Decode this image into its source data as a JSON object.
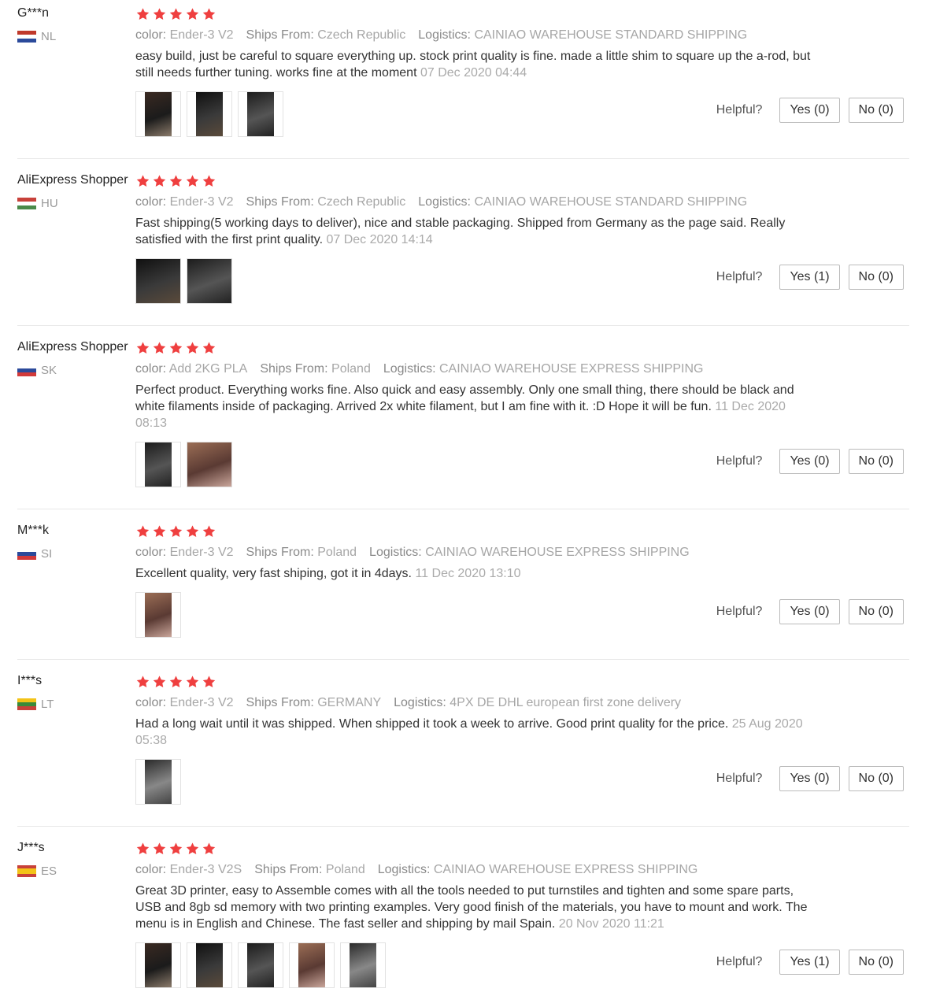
{
  "labels": {
    "color": "color:",
    "ships_from": "Ships From:",
    "logistics": "Logistics:",
    "helpful": "Helpful?"
  },
  "colors": {
    "star": "#ef3f3f",
    "divider": "#e8e8e8"
  },
  "reviews": [
    {
      "user": "G***n",
      "country": "NL",
      "flag": "flag-nl-icon",
      "stars": 5,
      "color": "Ender-3 V2",
      "ships_from": "Czech Republic",
      "logistics": "CAINIAO WAREHOUSE STANDARD SHIPPING",
      "text": "easy build, just be careful to square everything up. stock print quality is fine. made a little shim to square up the a-rod, but still needs further tuning. works fine at the moment",
      "date": "07 Dec 2020 04:44",
      "photos": 3,
      "yes": "Yes (0)",
      "no": "No (0)"
    },
    {
      "user": "AliExpress Shopper",
      "country": "HU",
      "flag": "flag-hu-icon",
      "stars": 5,
      "color": "Ender-3 V2",
      "ships_from": "Czech Republic",
      "logistics": "CAINIAO WAREHOUSE STANDARD SHIPPING",
      "text": "Fast shipping(5 working days to deliver), nice and stable packaging. Shipped from Germany as the page said. Really satisfied with the first print quality.",
      "date": "07 Dec 2020 14:14",
      "photos": 2,
      "yes": "Yes (1)",
      "no": "No (0)"
    },
    {
      "user": "AliExpress Shopper",
      "country": "SK",
      "flag": "flag-sk-icon",
      "stars": 5,
      "color": "Add 2KG PLA",
      "ships_from": "Poland",
      "logistics": "CAINIAO WAREHOUSE EXPRESS SHIPPING",
      "text": "Perfect product. Everything works fine. Also quick and easy assembly. Only one small thing, there should be black and white filaments inside of packaging. Arrived 2x white filament, but I am fine with it. :D Hope it will be fun.",
      "date": "11 Dec 2020 08:13",
      "photos": 2,
      "yes": "Yes (0)",
      "no": "No (0)"
    },
    {
      "user": "M***k",
      "country": "SI",
      "flag": "flag-si-icon",
      "stars": 5,
      "color": "Ender-3 V2",
      "ships_from": "Poland",
      "logistics": "CAINIAO WAREHOUSE EXPRESS SHIPPING",
      "text": "Excellent quality, very fast shiping, got it in 4days.",
      "date": "11 Dec 2020 13:10",
      "photos": 1,
      "yes": "Yes (0)",
      "no": "No (0)"
    },
    {
      "user": "I***s",
      "country": "LT",
      "flag": "flag-lt-icon",
      "stars": 5,
      "color": "Ender-3 V2",
      "ships_from": "GERMANY",
      "logistics": "4PX DE DHL european first zone delivery",
      "text": "Had a long wait until it was shipped. When shipped it took a week to arrive. Good print quality for the price.",
      "date": "25 Aug 2020 05:38",
      "photos": 1,
      "yes": "Yes (0)",
      "no": "No (0)"
    },
    {
      "user": "J***s",
      "country": "ES",
      "flag": "flag-es-icon",
      "stars": 5,
      "color": "Ender-3 V2S",
      "ships_from": "Poland",
      "logistics": "CAINIAO WAREHOUSE EXPRESS SHIPPING",
      "text": "Great 3D printer, easy to Assemble comes with all the tools needed to put turnstiles and tighten and some spare parts, USB and 8gb sd memory with two printing examples. Very good finish of the materials, you have to mount and work. The menu is in English and Chinese. The fast seller and shipping by mail Spain.",
      "date": "20 Nov 2020 11:21",
      "photos": 5,
      "yes": "Yes (1)",
      "no": "No (0)"
    }
  ]
}
